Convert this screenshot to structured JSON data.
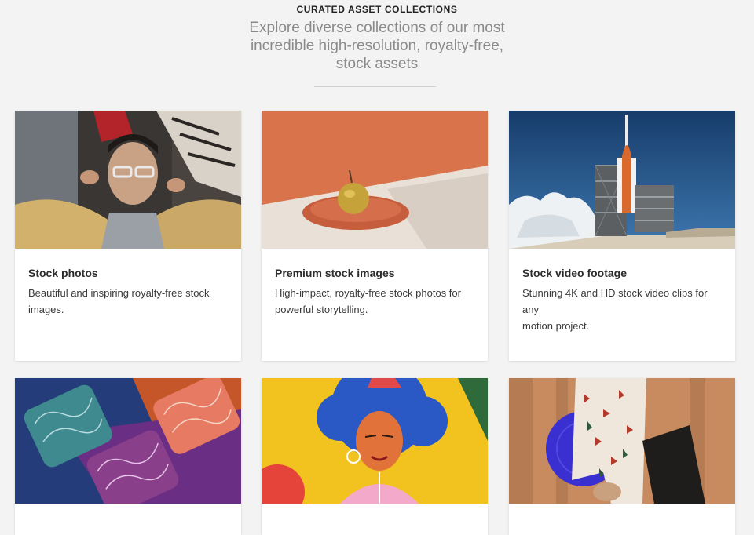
{
  "section": {
    "eyebrow": "CURATED ASSET COLLECTIONS",
    "subtitle_line1": "Explore diverse collections of our most",
    "subtitle_line2": "incredible high-resolution, royalty-free,",
    "subtitle_line3": "stock assets"
  },
  "cards": [
    {
      "title": "Stock photos",
      "desc_line1": "Beautiful and inspiring royalty-free stock",
      "desc_line2": "images."
    },
    {
      "title": "Premium stock images",
      "desc_line1": "High-impact, royalty-free stock photos for",
      "desc_line2": "powerful storytelling."
    },
    {
      "title": "Stock video footage",
      "desc_line1": "Stunning 4K and HD stock video clips for any",
      "desc_line2": "motion project."
    },
    {
      "title": "",
      "desc_line1": "",
      "desc_line2": ""
    },
    {
      "title": "",
      "desc_line1": "",
      "desc_line2": ""
    },
    {
      "title": "",
      "desc_line1": "",
      "desc_line2": ""
    }
  ],
  "colors": {
    "background": "#f3f3f3",
    "card": "#ffffff",
    "title": "#2c2c2c",
    "subtitle": "#8a8a8a"
  }
}
